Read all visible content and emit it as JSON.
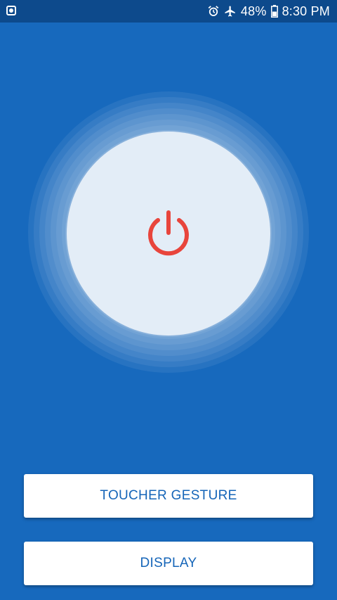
{
  "status_bar": {
    "battery": "48%",
    "time": "8:30 PM"
  },
  "main": {
    "power_icon": "power-icon",
    "power_color": "#e8453c",
    "button_bg": "#e3edf7"
  },
  "buttons": {
    "toucher_gesture": "TOUCHER GESTURE",
    "display": "DISPLAY"
  },
  "colors": {
    "background": "#1769bd",
    "status_bar": "#0d4a8c",
    "button_text": "#1565b8"
  }
}
